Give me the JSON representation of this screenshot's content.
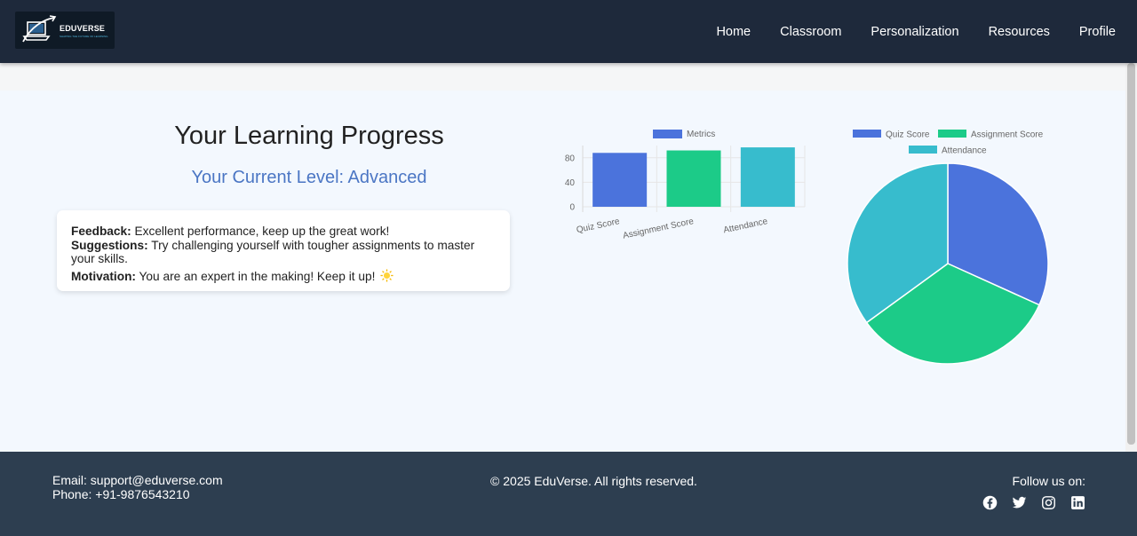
{
  "header": {
    "logo": {
      "text": "EDUVERSE",
      "tagline": "SHAPING THE FUTURE OF LEARNING"
    },
    "nav": [
      "Home",
      "Classroom",
      "Personalization",
      "Resources",
      "Profile"
    ]
  },
  "main": {
    "title": "Your Learning Progress",
    "level": "Your Current Level: Advanced",
    "feedback": {
      "feedback_label": "Feedback:",
      "feedback_text": " Excellent performance, keep up the great work!",
      "suggestions_label": "Suggestions:",
      "suggestions_text": " Try challenging yourself with tougher assignments to master your skills.",
      "motivation_label": "Motivation:",
      "motivation_text": " You are an expert in the making! Keep it up!",
      "motivation_icon": "sun-icon"
    }
  },
  "colors": {
    "quiz": "#4b73dc",
    "assignment": "#1ccb88",
    "attendance": "#37bccd",
    "header_bg": "#1e293b",
    "footer_bg": "#2d3e50",
    "level_text": "#4b76c4"
  },
  "chart_data": [
    {
      "type": "bar",
      "categories": [
        "Quiz Score",
        "Assignment Score",
        "Attendance"
      ],
      "series": [
        {
          "name": "Metrics",
          "values": [
            88,
            92,
            97
          ]
        }
      ],
      "yticks": [
        0,
        40,
        80
      ],
      "ylim": [
        0,
        100
      ],
      "legend": "top",
      "grid": true
    },
    {
      "type": "pie",
      "labels": [
        "Quiz Score",
        "Assignment Score",
        "Attendance"
      ],
      "values": [
        88,
        92,
        97
      ],
      "legend": "top"
    }
  ],
  "footer": {
    "email": "Email: support@eduverse.com",
    "phone": "Phone: +91-9876543210",
    "copyright": "© 2025 EduVerse. All rights reserved.",
    "follow": "Follow us on:",
    "socials": [
      "facebook-icon",
      "twitter-icon",
      "instagram-icon",
      "linkedin-icon"
    ]
  }
}
